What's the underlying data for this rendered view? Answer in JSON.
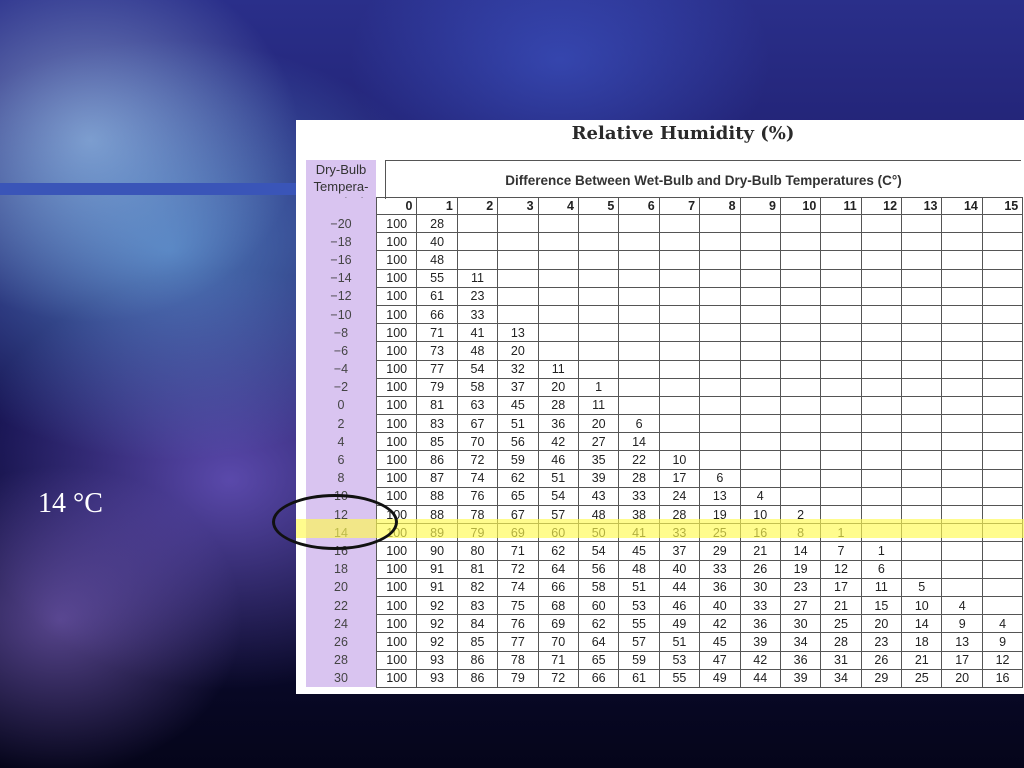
{
  "slide": {
    "label": "14 °C",
    "accent_stripe_color": "#3a55b8",
    "highlight_color": "#fff850"
  },
  "table": {
    "title": "Relative Humidity (%)",
    "dry_bulb_header": "Dry-Bulb Tempera- ture (°C)",
    "difference_header": "Difference Between Wet-Bulb and Dry-Bulb Temperatures (C°)",
    "columns": [
      "0",
      "1",
      "2",
      "3",
      "4",
      "5",
      "6",
      "7",
      "8",
      "9",
      "10",
      "11",
      "12",
      "13",
      "14",
      "15"
    ],
    "highlighted_row": "14",
    "rows": [
      {
        "t": "−20",
        "v": [
          "100",
          "28",
          "",
          "",
          "",
          "",
          "",
          "",
          "",
          "",
          "",
          "",
          "",
          "",
          "",
          ""
        ]
      },
      {
        "t": "−18",
        "v": [
          "100",
          "40",
          "",
          "",
          "",
          "",
          "",
          "",
          "",
          "",
          "",
          "",
          "",
          "",
          "",
          ""
        ]
      },
      {
        "t": "−16",
        "v": [
          "100",
          "48",
          "",
          "",
          "",
          "",
          "",
          "",
          "",
          "",
          "",
          "",
          "",
          "",
          "",
          ""
        ]
      },
      {
        "t": "−14",
        "v": [
          "100",
          "55",
          "11",
          "",
          "",
          "",
          "",
          "",
          "",
          "",
          "",
          "",
          "",
          "",
          "",
          ""
        ]
      },
      {
        "t": "−12",
        "v": [
          "100",
          "61",
          "23",
          "",
          "",
          "",
          "",
          "",
          "",
          "",
          "",
          "",
          "",
          "",
          "",
          ""
        ]
      },
      {
        "t": "−10",
        "v": [
          "100",
          "66",
          "33",
          "",
          "",
          "",
          "",
          "",
          "",
          "",
          "",
          "",
          "",
          "",
          "",
          ""
        ]
      },
      {
        "t": "−8",
        "v": [
          "100",
          "71",
          "41",
          "13",
          "",
          "",
          "",
          "",
          "",
          "",
          "",
          "",
          "",
          "",
          "",
          ""
        ]
      },
      {
        "t": "−6",
        "v": [
          "100",
          "73",
          "48",
          "20",
          "",
          "",
          "",
          "",
          "",
          "",
          "",
          "",
          "",
          "",
          "",
          ""
        ]
      },
      {
        "t": "−4",
        "v": [
          "100",
          "77",
          "54",
          "32",
          "11",
          "",
          "",
          "",
          "",
          "",
          "",
          "",
          "",
          "",
          "",
          ""
        ]
      },
      {
        "t": "−2",
        "v": [
          "100",
          "79",
          "58",
          "37",
          "20",
          "1",
          "",
          "",
          "",
          "",
          "",
          "",
          "",
          "",
          "",
          ""
        ]
      },
      {
        "t": "0",
        "v": [
          "100",
          "81",
          "63",
          "45",
          "28",
          "11",
          "",
          "",
          "",
          "",
          "",
          "",
          "",
          "",
          "",
          ""
        ]
      },
      {
        "t": "2",
        "v": [
          "100",
          "83",
          "67",
          "51",
          "36",
          "20",
          "6",
          "",
          "",
          "",
          "",
          "",
          "",
          "",
          "",
          ""
        ]
      },
      {
        "t": "4",
        "v": [
          "100",
          "85",
          "70",
          "56",
          "42",
          "27",
          "14",
          "",
          "",
          "",
          "",
          "",
          "",
          "",
          "",
          ""
        ]
      },
      {
        "t": "6",
        "v": [
          "100",
          "86",
          "72",
          "59",
          "46",
          "35",
          "22",
          "10",
          "",
          "",
          "",
          "",
          "",
          "",
          "",
          ""
        ]
      },
      {
        "t": "8",
        "v": [
          "100",
          "87",
          "74",
          "62",
          "51",
          "39",
          "28",
          "17",
          "6",
          "",
          "",
          "",
          "",
          "",
          "",
          ""
        ]
      },
      {
        "t": "10",
        "v": [
          "100",
          "88",
          "76",
          "65",
          "54",
          "43",
          "33",
          "24",
          "13",
          "4",
          "",
          "",
          "",
          "",
          "",
          ""
        ]
      },
      {
        "t": "12",
        "v": [
          "100",
          "88",
          "78",
          "67",
          "57",
          "48",
          "38",
          "28",
          "19",
          "10",
          "2",
          "",
          "",
          "",
          "",
          ""
        ]
      },
      {
        "t": "14",
        "v": [
          "100",
          "89",
          "79",
          "69",
          "60",
          "50",
          "41",
          "33",
          "25",
          "16",
          "8",
          "1",
          "",
          "",
          "",
          ""
        ]
      },
      {
        "t": "16",
        "v": [
          "100",
          "90",
          "80",
          "71",
          "62",
          "54",
          "45",
          "37",
          "29",
          "21",
          "14",
          "7",
          "1",
          "",
          "",
          ""
        ]
      },
      {
        "t": "18",
        "v": [
          "100",
          "91",
          "81",
          "72",
          "64",
          "56",
          "48",
          "40",
          "33",
          "26",
          "19",
          "12",
          "6",
          "",
          "",
          ""
        ]
      },
      {
        "t": "20",
        "v": [
          "100",
          "91",
          "82",
          "74",
          "66",
          "58",
          "51",
          "44",
          "36",
          "30",
          "23",
          "17",
          "11",
          "5",
          "",
          ""
        ]
      },
      {
        "t": "22",
        "v": [
          "100",
          "92",
          "83",
          "75",
          "68",
          "60",
          "53",
          "46",
          "40",
          "33",
          "27",
          "21",
          "15",
          "10",
          "4",
          ""
        ]
      },
      {
        "t": "24",
        "v": [
          "100",
          "92",
          "84",
          "76",
          "69",
          "62",
          "55",
          "49",
          "42",
          "36",
          "30",
          "25",
          "20",
          "14",
          "9",
          "4"
        ]
      },
      {
        "t": "26",
        "v": [
          "100",
          "92",
          "85",
          "77",
          "70",
          "64",
          "57",
          "51",
          "45",
          "39",
          "34",
          "28",
          "23",
          "18",
          "13",
          "9"
        ]
      },
      {
        "t": "28",
        "v": [
          "100",
          "93",
          "86",
          "78",
          "71",
          "65",
          "59",
          "53",
          "47",
          "42",
          "36",
          "31",
          "26",
          "21",
          "17",
          "12"
        ]
      },
      {
        "t": "30",
        "v": [
          "100",
          "93",
          "86",
          "79",
          "72",
          "66",
          "61",
          "55",
          "49",
          "44",
          "39",
          "34",
          "29",
          "25",
          "20",
          "16"
        ]
      }
    ]
  }
}
